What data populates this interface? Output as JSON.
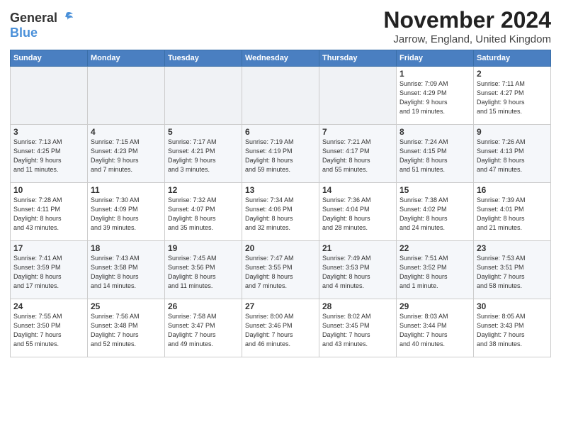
{
  "header": {
    "logo_general": "General",
    "logo_blue": "Blue",
    "month_title": "November 2024",
    "location": "Jarrow, England, United Kingdom"
  },
  "weekdays": [
    "Sunday",
    "Monday",
    "Tuesday",
    "Wednesday",
    "Thursday",
    "Friday",
    "Saturday"
  ],
  "weeks": [
    [
      {
        "day": "",
        "info": ""
      },
      {
        "day": "",
        "info": ""
      },
      {
        "day": "",
        "info": ""
      },
      {
        "day": "",
        "info": ""
      },
      {
        "day": "",
        "info": ""
      },
      {
        "day": "1",
        "info": "Sunrise: 7:09 AM\nSunset: 4:29 PM\nDaylight: 9 hours\nand 19 minutes."
      },
      {
        "day": "2",
        "info": "Sunrise: 7:11 AM\nSunset: 4:27 PM\nDaylight: 9 hours\nand 15 minutes."
      }
    ],
    [
      {
        "day": "3",
        "info": "Sunrise: 7:13 AM\nSunset: 4:25 PM\nDaylight: 9 hours\nand 11 minutes."
      },
      {
        "day": "4",
        "info": "Sunrise: 7:15 AM\nSunset: 4:23 PM\nDaylight: 9 hours\nand 7 minutes."
      },
      {
        "day": "5",
        "info": "Sunrise: 7:17 AM\nSunset: 4:21 PM\nDaylight: 9 hours\nand 3 minutes."
      },
      {
        "day": "6",
        "info": "Sunrise: 7:19 AM\nSunset: 4:19 PM\nDaylight: 8 hours\nand 59 minutes."
      },
      {
        "day": "7",
        "info": "Sunrise: 7:21 AM\nSunset: 4:17 PM\nDaylight: 8 hours\nand 55 minutes."
      },
      {
        "day": "8",
        "info": "Sunrise: 7:24 AM\nSunset: 4:15 PM\nDaylight: 8 hours\nand 51 minutes."
      },
      {
        "day": "9",
        "info": "Sunrise: 7:26 AM\nSunset: 4:13 PM\nDaylight: 8 hours\nand 47 minutes."
      }
    ],
    [
      {
        "day": "10",
        "info": "Sunrise: 7:28 AM\nSunset: 4:11 PM\nDaylight: 8 hours\nand 43 minutes."
      },
      {
        "day": "11",
        "info": "Sunrise: 7:30 AM\nSunset: 4:09 PM\nDaylight: 8 hours\nand 39 minutes."
      },
      {
        "day": "12",
        "info": "Sunrise: 7:32 AM\nSunset: 4:07 PM\nDaylight: 8 hours\nand 35 minutes."
      },
      {
        "day": "13",
        "info": "Sunrise: 7:34 AM\nSunset: 4:06 PM\nDaylight: 8 hours\nand 32 minutes."
      },
      {
        "day": "14",
        "info": "Sunrise: 7:36 AM\nSunset: 4:04 PM\nDaylight: 8 hours\nand 28 minutes."
      },
      {
        "day": "15",
        "info": "Sunrise: 7:38 AM\nSunset: 4:02 PM\nDaylight: 8 hours\nand 24 minutes."
      },
      {
        "day": "16",
        "info": "Sunrise: 7:39 AM\nSunset: 4:01 PM\nDaylight: 8 hours\nand 21 minutes."
      }
    ],
    [
      {
        "day": "17",
        "info": "Sunrise: 7:41 AM\nSunset: 3:59 PM\nDaylight: 8 hours\nand 17 minutes."
      },
      {
        "day": "18",
        "info": "Sunrise: 7:43 AM\nSunset: 3:58 PM\nDaylight: 8 hours\nand 14 minutes."
      },
      {
        "day": "19",
        "info": "Sunrise: 7:45 AM\nSunset: 3:56 PM\nDaylight: 8 hours\nand 11 minutes."
      },
      {
        "day": "20",
        "info": "Sunrise: 7:47 AM\nSunset: 3:55 PM\nDaylight: 8 hours\nand 7 minutes."
      },
      {
        "day": "21",
        "info": "Sunrise: 7:49 AM\nSunset: 3:53 PM\nDaylight: 8 hours\nand 4 minutes."
      },
      {
        "day": "22",
        "info": "Sunrise: 7:51 AM\nSunset: 3:52 PM\nDaylight: 8 hours\nand 1 minute."
      },
      {
        "day": "23",
        "info": "Sunrise: 7:53 AM\nSunset: 3:51 PM\nDaylight: 7 hours\nand 58 minutes."
      }
    ],
    [
      {
        "day": "24",
        "info": "Sunrise: 7:55 AM\nSunset: 3:50 PM\nDaylight: 7 hours\nand 55 minutes."
      },
      {
        "day": "25",
        "info": "Sunrise: 7:56 AM\nSunset: 3:48 PM\nDaylight: 7 hours\nand 52 minutes."
      },
      {
        "day": "26",
        "info": "Sunrise: 7:58 AM\nSunset: 3:47 PM\nDaylight: 7 hours\nand 49 minutes."
      },
      {
        "day": "27",
        "info": "Sunrise: 8:00 AM\nSunset: 3:46 PM\nDaylight: 7 hours\nand 46 minutes."
      },
      {
        "day": "28",
        "info": "Sunrise: 8:02 AM\nSunset: 3:45 PM\nDaylight: 7 hours\nand 43 minutes."
      },
      {
        "day": "29",
        "info": "Sunrise: 8:03 AM\nSunset: 3:44 PM\nDaylight: 7 hours\nand 40 minutes."
      },
      {
        "day": "30",
        "info": "Sunrise: 8:05 AM\nSunset: 3:43 PM\nDaylight: 7 hours\nand 38 minutes."
      }
    ]
  ]
}
